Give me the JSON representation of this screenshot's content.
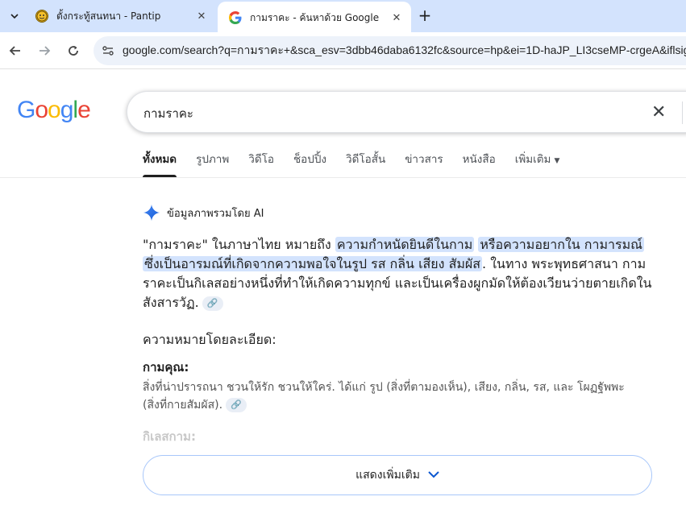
{
  "browser": {
    "tabs": [
      {
        "title": "ตั้งกระทู้สนทนา - Pantip",
        "favicon": "pantip-icon",
        "active": false
      },
      {
        "title": "กามราคะ - ค้นหาด้วย Google",
        "favicon": "google-g-icon",
        "active": true
      }
    ],
    "address": "google.com/search?q=กามราคะ+&sca_esv=3dbb46daba6132fc&source=hp&ei=1D-haJP_LI3cseMP-crgeA&iflsig="
  },
  "google": {
    "logo": "Google",
    "query": "กามราคะ",
    "nav_tabs": [
      "ทั้งหมด",
      "รูปภาพ",
      "วิดีโอ",
      "ช็อปปิ้ง",
      "วิดีโอสั้น",
      "ข่าวสาร",
      "หนังสือ",
      "เพิ่มเติม"
    ]
  },
  "ai_overview": {
    "label": "ข้อมูลภาพรวมโดย AI",
    "p1_a": "\"กามราคะ\" ในภาษาไทย หมายถึง ",
    "p1_hl1": "ความกำหนัดยินดีในกาม",
    "p1_hl2": "หรือความอยากใน กามารมณ์",
    "p1_hl3": "ซึ่งเป็นอารมณ์ที่เกิดจากความพอใจในรูป รส กลิ่น เสียง สัมผัส",
    "p1_b": ". ในทาง พระพุทธศาสนา กามราคะเป็นกิเลสอย่างหนึ่งที่ทำให้เกิดความทุกข์ และเป็นเครื่องผูกมัดให้ต้องเวียนว่ายตายเกิดในสังสารวัฏ.",
    "subheading": "ความหมายโดยละเอียด:",
    "term1": "กามคุณ:",
    "term1_desc": "สิ่งที่น่าปรารถนา ชวนให้รัก ชวนให้ใคร่. ได้แก่ รูป (สิ่งที่ตามองเห็น), เสียง, กลิ่น, รส, และ โผฏฐัพพะ (สิ่งที่กายสัมผัส).",
    "term2_faded": "กิเลสกาม:",
    "show_more": "แสดงเพิ่มเติม"
  },
  "colors": {
    "accent": "#0b57d0",
    "highlight": "#d3e3fd",
    "tabstrip": "#d3e3fd"
  }
}
